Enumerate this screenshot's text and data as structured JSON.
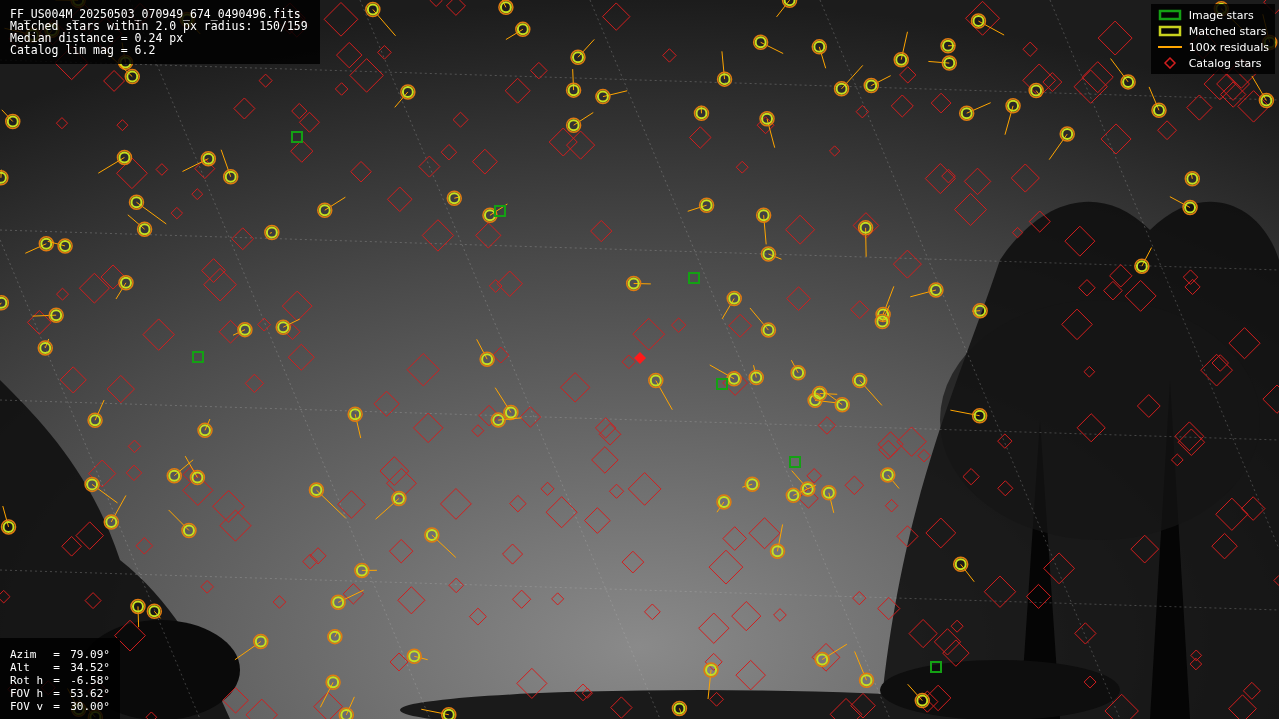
{
  "file_info": {
    "lines": [
      "FF_US004M_20250503_070949_674_0490496.fits",
      "Matched stars within 2.0 px radius: 150/159",
      "Median distance = 0.24 px",
      "Catalog lim mag = 6.2"
    ]
  },
  "legend": [
    {
      "label": "Image stars",
      "kind": "box",
      "color": "#14a014"
    },
    {
      "label": "Matched stars",
      "kind": "box",
      "color": "#c8d21e"
    },
    {
      "label": "100x residuals",
      "kind": "line",
      "color": "#ffa500"
    },
    {
      "label": "Catalog stars",
      "kind": "diamond",
      "color": "#d21e1e"
    }
  ],
  "pointing": [
    {
      "label": "Azim",
      "sep": "=",
      "value": "79.09°"
    },
    {
      "label": "Alt",
      "sep": "=",
      "value": "34.52°"
    },
    {
      "label": "Rot h",
      "sep": "=",
      "value": "-6.58°"
    },
    {
      "label": "FOV h",
      "sep": "=",
      "value": "53.62°"
    },
    {
      "label": "FOV v",
      "sep": "=",
      "value": "30.00°"
    }
  ]
}
